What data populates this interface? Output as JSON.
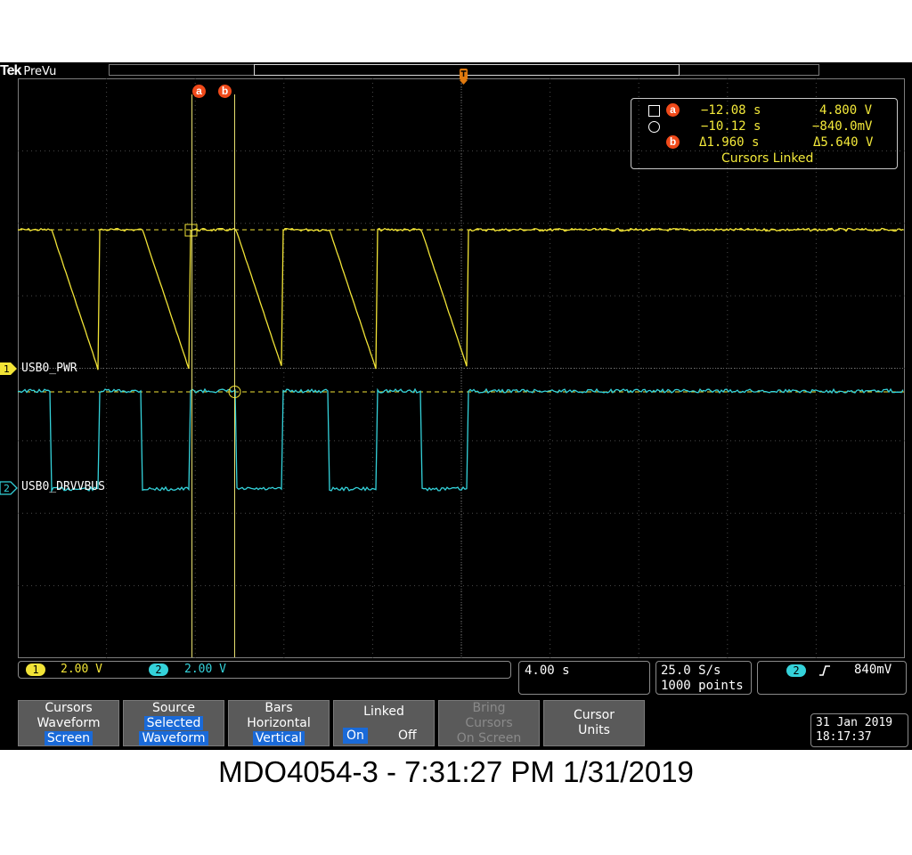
{
  "header": {
    "brand": "Tek",
    "mode": "PreVu"
  },
  "cursor_markers": {
    "a": "a",
    "b": "b"
  },
  "trigger_marker": "T",
  "channels": [
    {
      "number": "1",
      "label": "USB0_PWR",
      "scale": "2.00 V",
      "color": "#f2e437"
    },
    {
      "number": "2",
      "label": "USB0_DRVVBUS",
      "scale": "2.00 V",
      "color": "#34d2da"
    }
  ],
  "readout": {
    "row_a": {
      "time": "−12.08 s",
      "value": "4.800 V"
    },
    "row_circle": {
      "time": "−10.12 s",
      "value": "−840.0mV"
    },
    "row_b": {
      "time": "Δ1.960 s",
      "value": "Δ5.640 V"
    },
    "linked_label": "Cursors Linked"
  },
  "timebase": {
    "per_div": "4.00 s"
  },
  "acquisition": {
    "rate": "25.0 S/s",
    "points": "1000 points"
  },
  "trigger": {
    "source": "2",
    "slope_icon": "rising-edge-icon",
    "level": "840mV"
  },
  "menu": {
    "cursors": {
      "l1": "Cursors",
      "l2": "Waveform",
      "l3": "Screen"
    },
    "source": {
      "l1": "Source",
      "l2": "Selected",
      "l3": "Waveform"
    },
    "bars": {
      "l1": "Bars",
      "l2": "Horizontal",
      "l3": "Vertical"
    },
    "linked": {
      "l1": "Linked",
      "on": "On",
      "off": "Off"
    },
    "bring": {
      "l1": "Bring",
      "l2": "Cursors",
      "l3": "On Screen"
    },
    "units": {
      "l1": "Cursor",
      "l2": "Units"
    }
  },
  "datetime": {
    "date": "31 Jan  2019",
    "time": "18:17:37"
  },
  "caption": "MDO4054-3 - 7:31:27 PM    1/31/2019"
}
